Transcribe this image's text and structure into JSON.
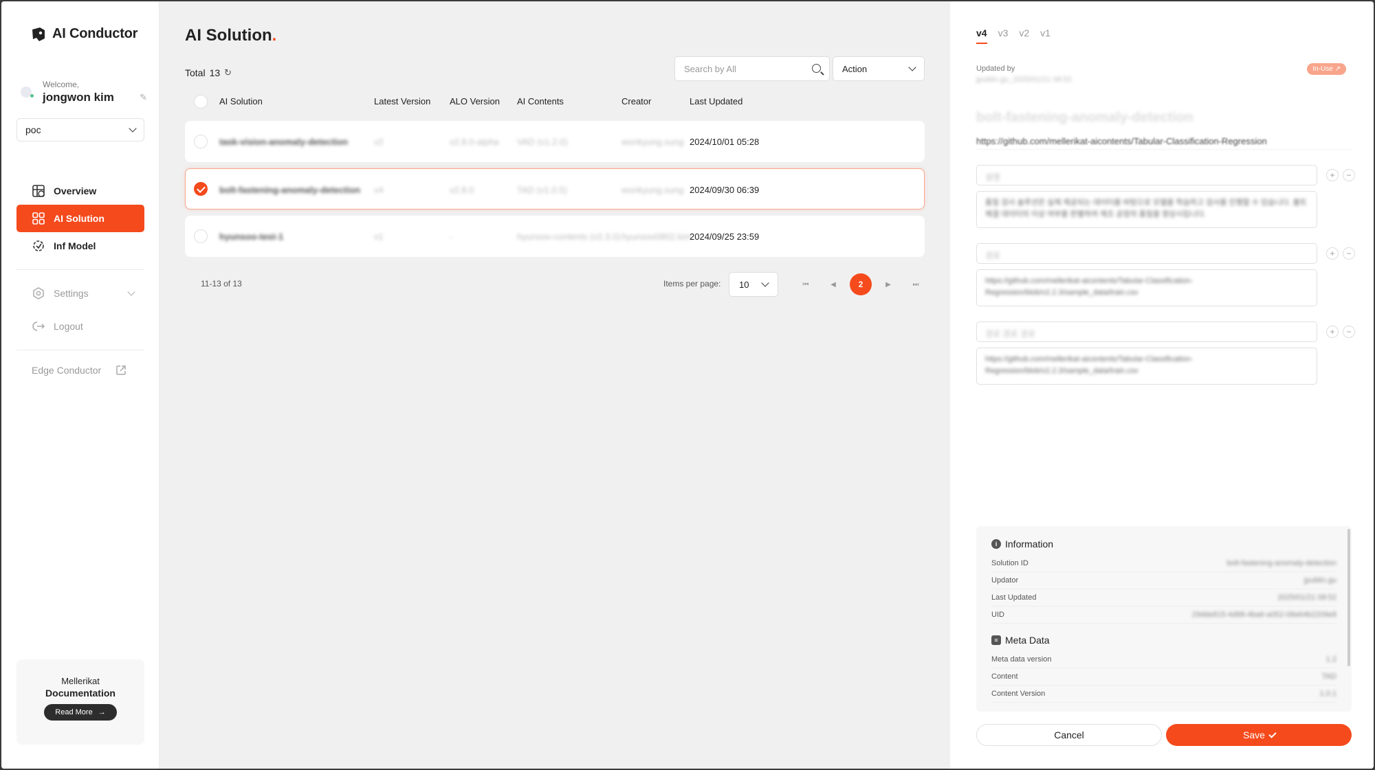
{
  "app": {
    "name": "AI Conductor"
  },
  "user": {
    "welcome": "Welcome,",
    "name": "jongwon kim"
  },
  "org": {
    "selected": "poc"
  },
  "nav": {
    "overview": "Overview",
    "ai_solution": "AI Solution",
    "inf_model": "Inf Model",
    "settings": "Settings",
    "logout": "Logout",
    "edge": "Edge Conductor"
  },
  "docs": {
    "line1": "Mellerikat",
    "line2": "Documentation",
    "button": "Read More"
  },
  "main": {
    "title": "AI Solution",
    "title_dot": ".",
    "total_label": "Total",
    "total": "13",
    "search_placeholder": "Search by All",
    "action_label": "Action",
    "columns": [
      "AI Solution",
      "Latest Version",
      "ALO Version",
      "AI Contents",
      "Creator",
      "Last Updated"
    ],
    "rows": [
      {
        "name": "task-vision-anomaly-detection",
        "latest": "v2",
        "alo": "v2.8.0-alpha",
        "contents": "VAD (v1.2.0)",
        "creator": "wonkyung.sung",
        "updated": "2024/10/01 05:28",
        "selected": false
      },
      {
        "name": "bolt-fastening-anomaly-detection",
        "latest": "v4",
        "alo": "v2.8.0",
        "contents": "TAD (v1.0.5)",
        "creator": "wonkyung.sung",
        "updated": "2024/09/30 06:39",
        "selected": true
      },
      {
        "name": "hyunsoo-test-1",
        "latest": "v1",
        "alo": "-",
        "contents": "hyunsoo-contents (v2.3.0)",
        "creator": "hyunsoo0802.kim",
        "updated": "2024/09/25 23:59",
        "selected": false
      }
    ],
    "range": "11-13 of 13",
    "items_per_page_label": "Items per page:",
    "items_per_page": "10",
    "current_page": "2"
  },
  "panel": {
    "tabs": [
      "v4",
      "v3",
      "v2",
      "v1"
    ],
    "active_tab": "v4",
    "updated_by_label": "Updated by",
    "updated_by_value": "jpublin.gu_2025/01/21 08:52",
    "badge": "In-Use",
    "solution_name": "bolt-fastening-anomaly-detection",
    "repo_url": "https://github.com/mellerikat-aicontents/Tabular-Classification-Regression",
    "fields": [
      {
        "key": "설명",
        "value": "품질 검사 솔루션은 실제 제공되는 데이터를 바탕으로 모델을 학습하고 검사를 진행할 수 있습니다. 볼트 체결 데이터의 이상 여부를 판별하여 제조 공정의 품질을 향상시킵니다."
      },
      {
        "key": "경로",
        "value": "https://github.com/mellerikat-aicontents/Tabular-Classification-Regression/blob/v2.2.3/sample_data/train.csv"
      },
      {
        "key": "경로 경로 경로",
        "value": "https://github.com/mellerikat-aicontents/Tabular-Classification-Regression/blob/v2.2.3/sample_data/train.csv"
      }
    ],
    "info_title": "Information",
    "info": [
      {
        "label": "Solution ID",
        "value": "bolt-fastening-anomaly-detection"
      },
      {
        "label": "Updator",
        "value": "jpublin.gu"
      },
      {
        "label": "Last Updated",
        "value": "2025/01/21 08:52"
      },
      {
        "label": "UID",
        "value": "29dde815-4d88-4ba6-a052-08e64b2209e8"
      }
    ],
    "meta_title": "Meta Data",
    "meta": [
      {
        "label": "Meta data version",
        "value": "1.2"
      },
      {
        "label": "Content",
        "value": "TAD"
      },
      {
        "label": "Content Version",
        "value": "1.0.1"
      }
    ],
    "cancel": "Cancel",
    "save": "Save"
  },
  "colors": {
    "accent": "#f54a1c",
    "accent_light": "#f8a58b"
  }
}
